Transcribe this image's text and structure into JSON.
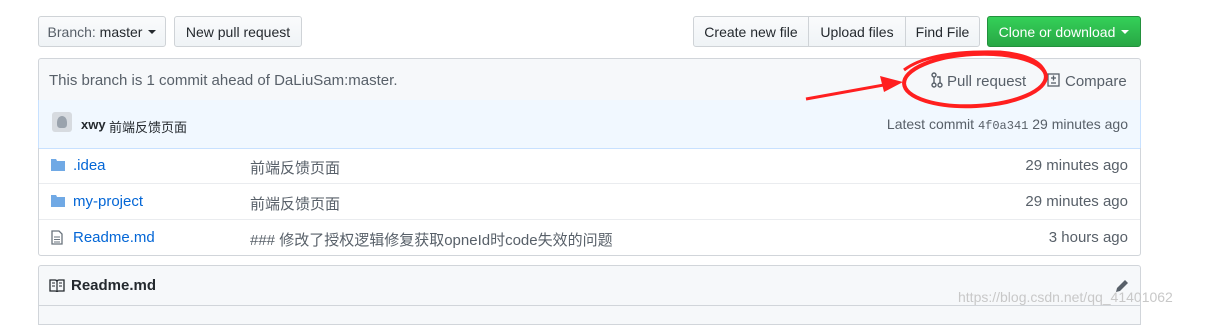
{
  "toolbar": {
    "branch_label": "Branch:",
    "branch_value": "master",
    "new_pull_request": "New pull request",
    "create_new_file": "Create new file",
    "upload_files": "Upload files",
    "find_file": "Find File",
    "clone_or_download": "Clone or download"
  },
  "branch_info": {
    "status": "This branch is 1 commit ahead of DaLiuSam:master.",
    "pull_request": "Pull request",
    "compare": "Compare"
  },
  "latest_commit": {
    "author": "xwy",
    "message": "前端反馈页面",
    "label": "Latest commit",
    "sha": "4f0a341",
    "time": "29 minutes ago"
  },
  "files": [
    {
      "name": ".idea",
      "type": "folder",
      "message": "前端反馈页面",
      "age": "29 minutes ago"
    },
    {
      "name": "my-project",
      "type": "folder",
      "message": "前端反馈页面",
      "age": "29 minutes ago"
    },
    {
      "name": "Readme.md",
      "type": "file",
      "message": "### 修改了授权逻辑修复获取opneId时code失效的问题",
      "age": "3 hours ago"
    }
  ],
  "readme": {
    "title": "Readme.md"
  },
  "watermark": "https://blog.csdn.net/qq_41401062",
  "colors": {
    "annotation": "#ff1f1f",
    "clone_button": "#28a745",
    "link": "#0366d6"
  },
  "icons": [
    "caret-down-icon",
    "pull-request-icon",
    "compare-icon",
    "folder-icon",
    "file-icon",
    "book-icon",
    "pencil-icon"
  ]
}
